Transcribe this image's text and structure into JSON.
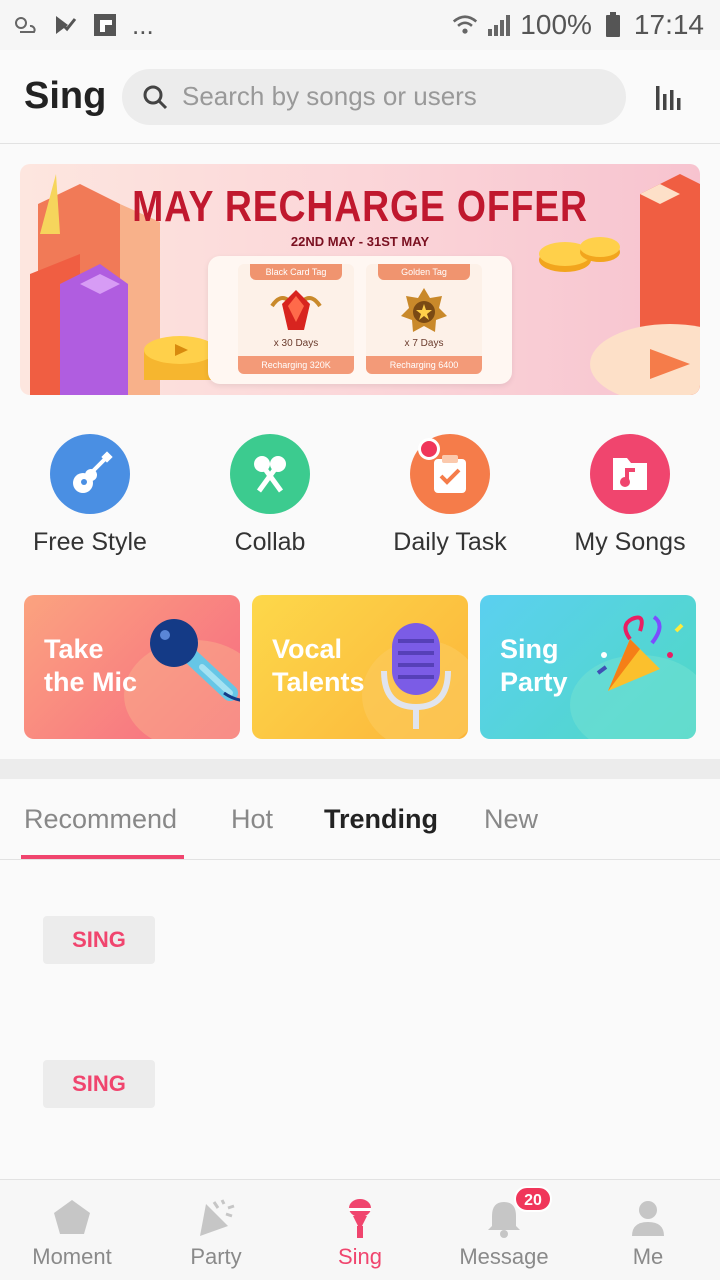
{
  "status_bar": {
    "dots": "...",
    "battery": "100%",
    "time": "17:14"
  },
  "header": {
    "title": "Sing",
    "search_placeholder": "Search by songs or users"
  },
  "banner": {
    "title": "MAY RECHARGE OFFER",
    "subtitle": "22ND MAY - 31ST MAY",
    "offers": [
      {
        "tag": "Black Card Tag",
        "days": "x 30 Days",
        "foot": "Recharging 320K"
      },
      {
        "tag": "Golden Tag",
        "days": "x 7 Days",
        "foot": "Recharging 6400"
      }
    ]
  },
  "quick_actions": [
    {
      "label": "Free Style",
      "color": "#4a8fe3",
      "icon": "guitar-icon"
    },
    {
      "label": "Collab",
      "color": "#3ccb8f",
      "icon": "duet-mics-icon"
    },
    {
      "label": "Daily Task",
      "color": "#f57c4a",
      "icon": "clipboard-check-icon"
    },
    {
      "label": "My Songs",
      "color": "#f0456e",
      "icon": "music-folder-icon"
    }
  ],
  "cards": [
    {
      "label": "Take\nthe Mic",
      "icon": "microphone-icon"
    },
    {
      "label": "Vocal\nTalents",
      "icon": "studio-mic-icon"
    },
    {
      "label": "Sing\nParty",
      "icon": "party-popper-icon"
    }
  ],
  "tabs": [
    "Recommend",
    "Hot",
    "Trending",
    "New"
  ],
  "list": {
    "sing_label": "SING"
  },
  "bottom_nav": [
    {
      "label": "Moment",
      "icon": "pentagon-icon"
    },
    {
      "label": "Party",
      "icon": "party-icon"
    },
    {
      "label": "Sing",
      "icon": "mic-icon"
    },
    {
      "label": "Message",
      "icon": "bell-icon",
      "badge": "20"
    },
    {
      "label": "Me",
      "icon": "person-icon"
    }
  ],
  "colors": {
    "accent": "#f0456e",
    "banner_title": "#c0182e"
  }
}
